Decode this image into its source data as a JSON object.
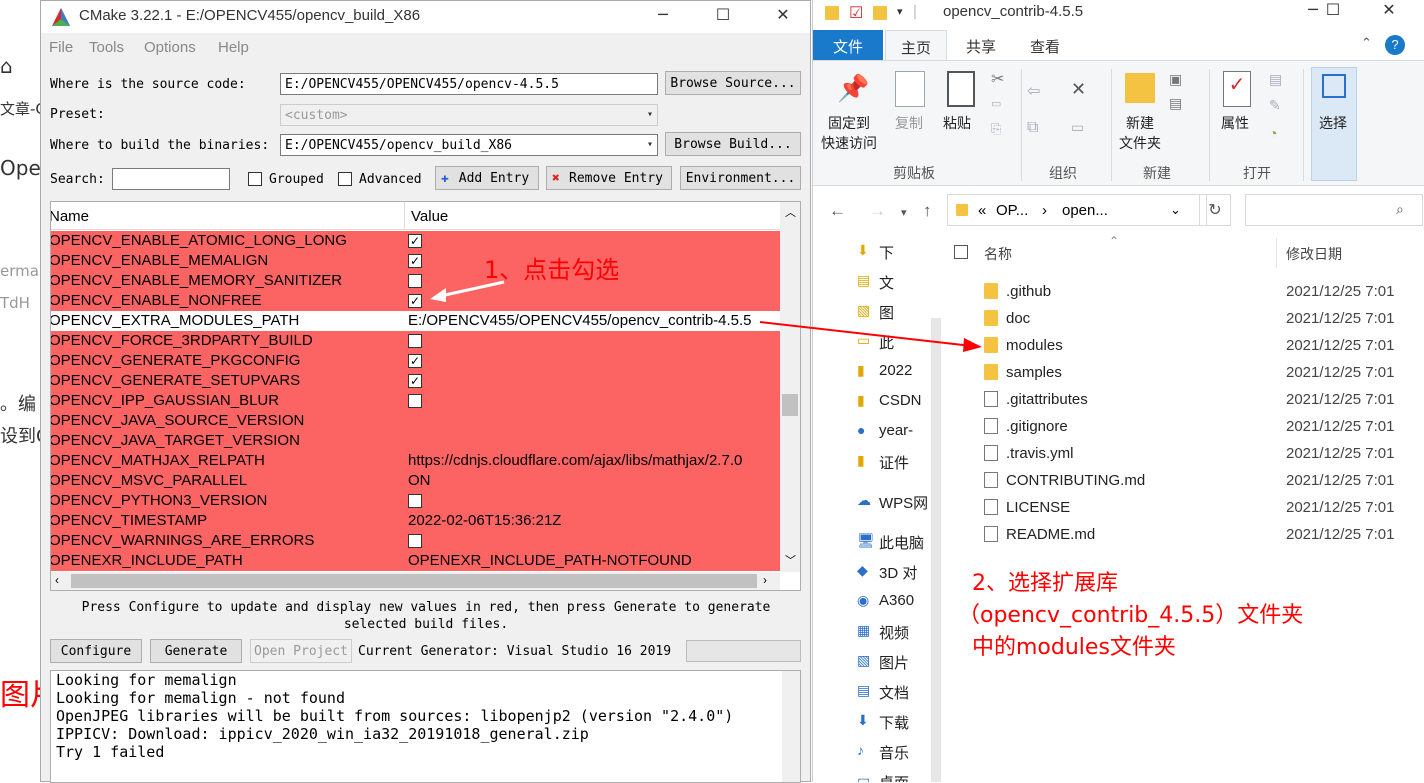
{
  "bg": {
    "lines": [
      "文章-CS",
      "Open",
      "ermar",
      "TdH",
      "。编",
      "设到O",
      "图片"
    ]
  },
  "cmake": {
    "title": "CMake 3.22.1 - E:/OPENCV455/opencv_build_X86",
    "menu": [
      "File",
      "Tools",
      "Options",
      "Help"
    ],
    "source_label": "Where is the source code:",
    "source_value": "E:/OPENCV455/OPENCV455/opencv-4.5.5",
    "browse_source": "Browse Source...",
    "preset_label": "Preset:",
    "preset_value": "<custom>",
    "build_label": "Where to build the binaries:",
    "build_value": "E:/OPENCV455/opencv_build_X86",
    "browse_build": "Browse Build...",
    "search_label": "Search:",
    "grouped": "Grouped",
    "advanced": "Advanced",
    "add_entry": "Add Entry",
    "remove_entry": "Remove Entry",
    "environment": "Environment...",
    "col_name": "Name",
    "col_value": "Value",
    "rows": [
      {
        "name": "OPENCV_ENABLE_ATOMIC_LONG_LONG",
        "checked": true,
        "sel": false
      },
      {
        "name": "OPENCV_ENABLE_MEMALIGN",
        "checked": true,
        "sel": false
      },
      {
        "name": "OPENCV_ENABLE_MEMORY_SANITIZER",
        "checked": false,
        "sel": false
      },
      {
        "name": "OPENCV_ENABLE_NONFREE",
        "checked": true,
        "sel": false
      },
      {
        "name": "OPENCV_EXTRA_MODULES_PATH",
        "value": "E:/OPENCV455/OPENCV455/opencv_contrib-4.5.5",
        "sel": true
      },
      {
        "name": "OPENCV_FORCE_3RDPARTY_BUILD",
        "checked": false,
        "sel": false
      },
      {
        "name": "OPENCV_GENERATE_PKGCONFIG",
        "checked": true,
        "sel": false
      },
      {
        "name": "OPENCV_GENERATE_SETUPVARS",
        "checked": true,
        "sel": false
      },
      {
        "name": "OPENCV_IPP_GAUSSIAN_BLUR",
        "checked": false,
        "sel": false
      },
      {
        "name": "OPENCV_JAVA_SOURCE_VERSION",
        "value": "",
        "sel": false
      },
      {
        "name": "OPENCV_JAVA_TARGET_VERSION",
        "value": "",
        "sel": false
      },
      {
        "name": "OPENCV_MATHJAX_RELPATH",
        "value": "https://cdnjs.cloudflare.com/ajax/libs/mathjax/2.7.0",
        "sel": false
      },
      {
        "name": "OPENCV_MSVC_PARALLEL",
        "value": "ON",
        "sel": false
      },
      {
        "name": "OPENCV_PYTHON3_VERSION",
        "checked": false,
        "sel": false
      },
      {
        "name": "OPENCV_TIMESTAMP",
        "value": "2022-02-06T15:36:21Z",
        "sel": false
      },
      {
        "name": "OPENCV_WARNINGS_ARE_ERRORS",
        "checked": false,
        "sel": false
      },
      {
        "name": "OPENEXR_INCLUDE_PATH",
        "value": "OPENEXR_INCLUDE_PATH-NOTFOUND",
        "sel": false
      }
    ],
    "hint": "Press Configure to update and display new values in red, then press Generate to generate selected build files.",
    "configure": "Configure",
    "generate": "Generate",
    "open_project": "Open Project",
    "current_generator": "Current Generator: Visual Studio 16 2019",
    "log": [
      "Looking for memalign",
      "Looking for memalign - not found",
      "OpenJPEG libraries will be built from sources: libopenjp2 (version \"2.4.0\")",
      "IPPICV: Download: ippicv_2020_win_ia32_20191018_general.zip",
      "Try 1 failed"
    ]
  },
  "explorer": {
    "title": "opencv_contrib-4.5.5",
    "tabs": [
      "文件",
      "主页",
      "共享",
      "查看"
    ],
    "ribbon": {
      "pin": "固定到\n快速访问",
      "copy": "复制",
      "paste": "粘贴",
      "clipboard": "剪贴板",
      "organize": "组织",
      "newfolder": "新建\n文件夹",
      "new": "新建",
      "properties": "属性",
      "open": "打开",
      "select": "选择"
    },
    "breadcrumb": [
      "«",
      "OP...",
      "›",
      "open..."
    ],
    "col_name": "名称",
    "col_date": "修改日期",
    "nav": [
      "下",
      "文",
      "图",
      "此",
      "2022",
      "CSDN",
      "year-",
      "证件",
      "WPS网",
      "此电脑",
      "3D 对",
      "A360",
      "视频",
      "图片",
      "文档",
      "下载",
      "音乐",
      "桌面"
    ],
    "files": [
      {
        "name": ".github",
        "date": "2021/12/25 7:01",
        "type": "folder"
      },
      {
        "name": "doc",
        "date": "2021/12/25 7:01",
        "type": "folder"
      },
      {
        "name": "modules",
        "date": "2021/12/25 7:01",
        "type": "folder"
      },
      {
        "name": "samples",
        "date": "2021/12/25 7:01",
        "type": "folder"
      },
      {
        "name": ".gitattributes",
        "date": "2021/12/25 7:01",
        "type": "doc"
      },
      {
        "name": ".gitignore",
        "date": "2021/12/25 7:01",
        "type": "doc"
      },
      {
        "name": ".travis.yml",
        "date": "2021/12/25 7:01",
        "type": "doc"
      },
      {
        "name": "CONTRIBUTING.md",
        "date": "2021/12/25 7:01",
        "type": "doc"
      },
      {
        "name": "LICENSE",
        "date": "2021/12/25 7:01",
        "type": "doc"
      },
      {
        "name": "README.md",
        "date": "2021/12/25 7:01",
        "type": "doc"
      }
    ]
  },
  "annotations": {
    "a1": "1、点击勾选",
    "a2": [
      "2、选择扩展库",
      "（opencv_contrib_4.5.5）文件夹",
      "中的modules文件夹"
    ]
  }
}
